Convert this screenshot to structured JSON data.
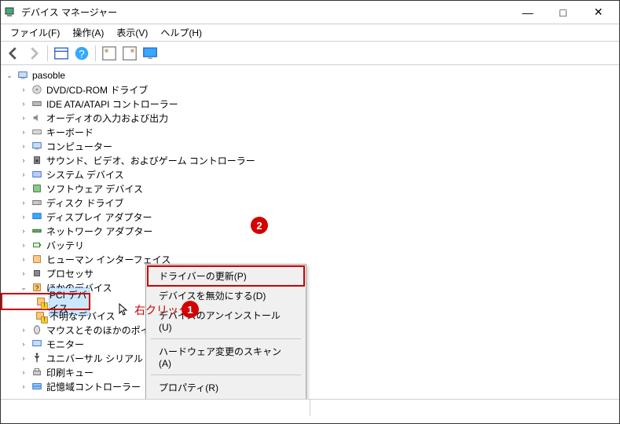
{
  "window": {
    "title": "デバイス マネージャー"
  },
  "menubar": {
    "file": "ファイル(F)",
    "action": "操作(A)",
    "view": "表示(V)",
    "help": "ヘルプ(H)"
  },
  "tree": {
    "root": "pasoble",
    "nodes": [
      "DVD/CD-ROM ドライブ",
      "IDE ATA/ATAPI コントローラー",
      "オーディオの入力および出力",
      "キーボード",
      "コンピューター",
      "サウンド、ビデオ、およびゲーム コントローラー",
      "システム デバイス",
      "ソフトウェア デバイス",
      "ディスク ドライブ",
      "ディスプレイ アダプター",
      "ネットワーク アダプター",
      "バッテリ",
      "ヒューマン インターフェイス",
      "プロセッサ",
      "ほかのデバイス",
      "マウスとそのほかのポインティング デバイス",
      "モニター",
      "ユニバーサル シリアル バス コントローラー",
      "印刷キュー",
      "記憶域コントローラー"
    ],
    "other_devices": {
      "pci": "PCI デバイス",
      "unknown": "不明なデバイス"
    }
  },
  "context_menu": {
    "update": "ドライバーの更新(P)",
    "disable": "デバイスを無効にする(D)",
    "uninstall": "デバイスのアンインストール(U)",
    "scan": "ハードウェア変更のスキャン(A)",
    "properties": "プロパティ(R)"
  },
  "annotations": {
    "right_click": "右クリック",
    "bubble1": "1",
    "bubble2": "2"
  }
}
